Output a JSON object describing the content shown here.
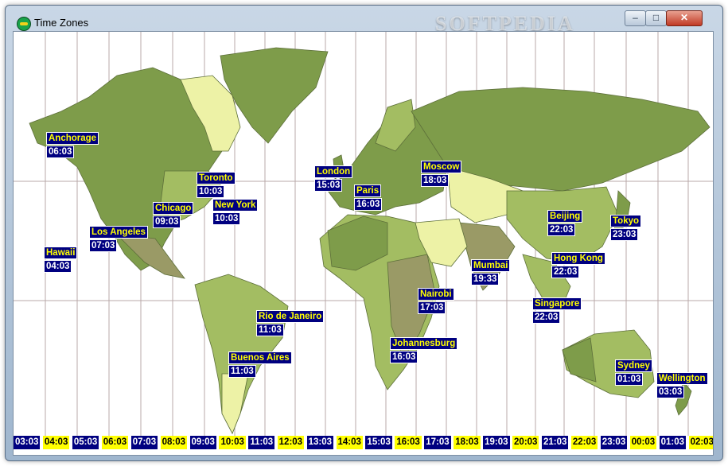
{
  "window": {
    "title": "Time Zones",
    "watermark": "SOFTPEDIA",
    "minimize": "–",
    "maximize": "□",
    "close": "✕"
  },
  "colors": {
    "label_bg": "#000080",
    "label_name": "#ffff00",
    "label_time": "#ffffff",
    "land_dark": "#7e9c4a",
    "land_mid": "#a3bd62",
    "land_light": "#edf2a6",
    "land_olive": "#9a9a66"
  },
  "cities": [
    {
      "name": "Anchorage",
      "time": "06:03"
    },
    {
      "name": "Toronto",
      "time": "10:03"
    },
    {
      "name": "Chicago",
      "time": "09:03"
    },
    {
      "name": "New York",
      "time": "10:03"
    },
    {
      "name": "Los Angeles",
      "time": "07:03"
    },
    {
      "name": "Hawaii",
      "time": "04:03"
    },
    {
      "name": "London",
      "time": "15:03"
    },
    {
      "name": "Paris",
      "time": "16:03"
    },
    {
      "name": "Moscow",
      "time": "18:03"
    },
    {
      "name": "Beijing",
      "time": "22:03"
    },
    {
      "name": "Tokyo",
      "time": "23:03"
    },
    {
      "name": "Hong Kong",
      "time": "22:03"
    },
    {
      "name": "Mumbai",
      "time": "19:33"
    },
    {
      "name": "Nairobi",
      "time": "17:03"
    },
    {
      "name": "Singapore",
      "time": "22:03"
    },
    {
      "name": "Rio de Janeiro",
      "time": "11:03"
    },
    {
      "name": "Buenos Aires",
      "time": "11:03"
    },
    {
      "name": "Johannesburg",
      "time": "16:03"
    },
    {
      "name": "Sydney",
      "time": "01:03"
    },
    {
      "name": "Wellington",
      "time": "03:03"
    }
  ],
  "timebar": [
    "03:03",
    "04:03",
    "05:03",
    "06:03",
    "07:03",
    "08:03",
    "09:03",
    "10:03",
    "11:03",
    "12:03",
    "13:03",
    "14:03",
    "15:03",
    "16:03",
    "17:03",
    "18:03",
    "19:03",
    "20:03",
    "21:03",
    "22:03",
    "23:03",
    "00:03",
    "01:03",
    "02:03"
  ]
}
